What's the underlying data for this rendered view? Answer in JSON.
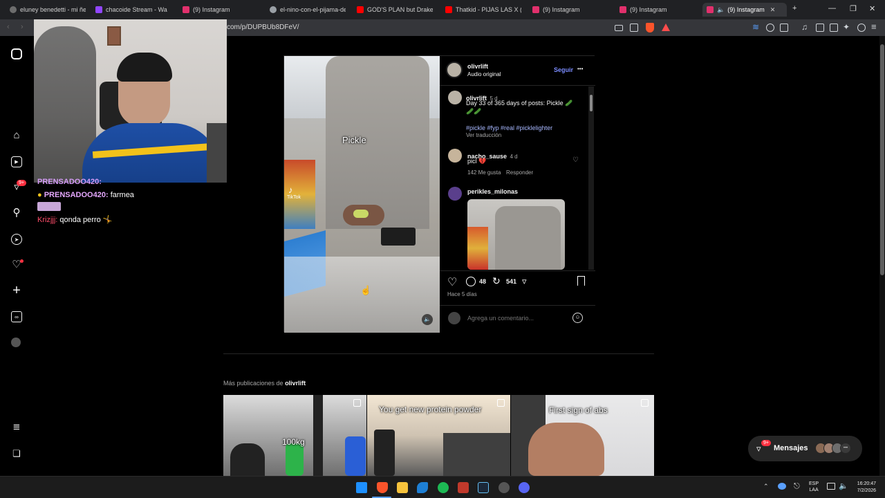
{
  "browser": {
    "tabs": [
      {
        "title": "eluney benedetti - mi ñer¹",
        "color": "#6d6d6d"
      },
      {
        "title": "chacoide Stream - Wa",
        "color": "#9146ff"
      },
      {
        "title": "(9) Instagram",
        "color": "#e1306c"
      },
      {
        "title": "el-nino-con-el-pijama-de-",
        "color": "#9aa0a6"
      },
      {
        "title": "GOD'S PLAN but Drake st",
        "color": "#ff0000"
      },
      {
        "title": "Thatkid - PIJAS LAS X (Offi",
        "color": "#ff0000"
      },
      {
        "title": "(9) Instagram",
        "color": "#e1306c"
      },
      {
        "title": "(9) Instagram",
        "color": "#e1306c"
      },
      {
        "title": "(9) Instagram",
        "color": "#e1306c"
      }
    ],
    "url": "com/p/DUPBUb8DFeV/",
    "new_tab_label": "+"
  },
  "nav": {
    "notifications_badge": "9+"
  },
  "chat": [
    {
      "user": "PRENSADOO420:",
      "text": ""
    },
    {
      "user": "PRENSADOO420:",
      "text": "farmea"
    },
    {
      "user": "Krizjjj:",
      "text": "qonda perro 🤸"
    }
  ],
  "post": {
    "video_caption": "Pickle",
    "tiktok_label": "TikTok",
    "author": "olivrlift",
    "audio": "Audio original",
    "follow_label": "Seguir",
    "more_label": "•••",
    "caption": {
      "user": "olivrlift",
      "time": "5 d",
      "text": "Day 33 of 365 days of posts: Pickle 🥒",
      "emoji_line": "🥒🥒",
      "hashtags": "#pickle #fyp #real #picklelighter",
      "translate": "Ver traducción"
    },
    "comments": [
      {
        "user": "nacho_sause",
        "time": "4 d",
        "text": "picl 💔",
        "likes": "142 Me gusta",
        "reply": "Responder"
      },
      {
        "user": "perikles_milonas",
        "time": "",
        "text": "",
        "likes": "",
        "reply": ""
      }
    ],
    "comment_count": "48",
    "repost_count": "541",
    "posted_ago": "Hace 5 días",
    "comment_placeholder": "Agrega un comentario..."
  },
  "more_posts": {
    "heading_prefix": "Más publicaciones de ",
    "heading_user": "olivrlift",
    "items": [
      {
        "caption": "100kg"
      },
      {
        "caption": "You get new protein powder"
      },
      {
        "caption": "First sign of abs"
      }
    ]
  },
  "messages": {
    "label": "Mensajes",
    "badge": "9+"
  },
  "taskbar": {
    "language": "ESP",
    "layout": "LAA",
    "time": "16:20:47",
    "date": "7/2/2026"
  }
}
